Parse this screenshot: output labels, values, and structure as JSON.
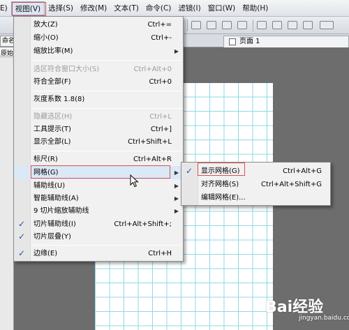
{
  "menubar": {
    "items": [
      "E)",
      "视图(V)",
      "选择(S)",
      "修改(M)",
      "文本(T)",
      "命令(C)",
      "滤镜(I)",
      "窗口(W)",
      "帮助(H)"
    ]
  },
  "tabs": {
    "left_label": "命名",
    "left_label_2": "原始",
    "page_tab": "页面 1"
  },
  "view_menu": {
    "items": [
      {
        "label": "放大(Z)",
        "shortcut": "Ctrl+="
      },
      {
        "label": "缩小(O)",
        "shortcut": "Ctrl+-"
      },
      {
        "label": "缩放比率(M)",
        "shortcut": ""
      },
      {
        "label": "选区符合窗口大小(S)",
        "shortcut": "Ctrl+Alt+0"
      },
      {
        "label": "符合全部(F)",
        "shortcut": "Ctrl+0"
      },
      {
        "label": "灰度系数 1.8(8)",
        "shortcut": ""
      },
      {
        "label": "隐藏选区(H)",
        "shortcut": "Ctrl+L"
      },
      {
        "label": "工具提示(T)",
        "shortcut": "Ctrl+]"
      },
      {
        "label": "显示全部(L)",
        "shortcut": "Ctrl+Shift+L"
      },
      {
        "label": "标尺(R)",
        "shortcut": "Ctrl+Alt+R"
      },
      {
        "label": "网格(G)",
        "shortcut": ""
      },
      {
        "label": "辅助线(U)",
        "shortcut": ""
      },
      {
        "label": "智能辅助线(A)",
        "shortcut": ""
      },
      {
        "label": "9 切片缩放辅助线",
        "shortcut": ""
      },
      {
        "label": "切片辅助线(I)",
        "shortcut": "Ctrl+Alt+Shift+;"
      },
      {
        "label": "切片层叠(Y)",
        "shortcut": ""
      },
      {
        "label": "边缘(E)",
        "shortcut": "Ctrl+H"
      }
    ]
  },
  "grid_submenu": {
    "items": [
      {
        "label": "显示网格(G)",
        "shortcut": "Ctrl+Alt+G"
      },
      {
        "label": "对齐网格(S)",
        "shortcut": "Ctrl+Alt+Shift+G"
      },
      {
        "label": "编辑网格(E)...",
        "shortcut": ""
      }
    ]
  },
  "watermark": {
    "brand": "Bai经验",
    "url": "jingyan.baidu.com"
  },
  "colors": {
    "grid_line": "#8fd9e6",
    "highlight_box": "#d9534f",
    "check_mark": "#2457a8"
  }
}
